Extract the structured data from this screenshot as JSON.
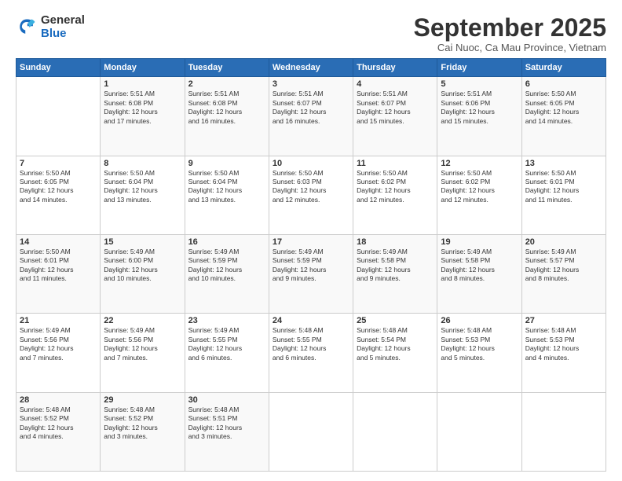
{
  "header": {
    "logo_general": "General",
    "logo_blue": "Blue",
    "title": "September 2025",
    "location": "Cai Nuoc, Ca Mau Province, Vietnam"
  },
  "days_of_week": [
    "Sunday",
    "Monday",
    "Tuesday",
    "Wednesday",
    "Thursday",
    "Friday",
    "Saturday"
  ],
  "weeks": [
    [
      {
        "day": "",
        "info": ""
      },
      {
        "day": "1",
        "info": "Sunrise: 5:51 AM\nSunset: 6:08 PM\nDaylight: 12 hours\nand 17 minutes."
      },
      {
        "day": "2",
        "info": "Sunrise: 5:51 AM\nSunset: 6:08 PM\nDaylight: 12 hours\nand 16 minutes."
      },
      {
        "day": "3",
        "info": "Sunrise: 5:51 AM\nSunset: 6:07 PM\nDaylight: 12 hours\nand 16 minutes."
      },
      {
        "day": "4",
        "info": "Sunrise: 5:51 AM\nSunset: 6:07 PM\nDaylight: 12 hours\nand 15 minutes."
      },
      {
        "day": "5",
        "info": "Sunrise: 5:51 AM\nSunset: 6:06 PM\nDaylight: 12 hours\nand 15 minutes."
      },
      {
        "day": "6",
        "info": "Sunrise: 5:50 AM\nSunset: 6:05 PM\nDaylight: 12 hours\nand 14 minutes."
      }
    ],
    [
      {
        "day": "7",
        "info": "Sunrise: 5:50 AM\nSunset: 6:05 PM\nDaylight: 12 hours\nand 14 minutes."
      },
      {
        "day": "8",
        "info": "Sunrise: 5:50 AM\nSunset: 6:04 PM\nDaylight: 12 hours\nand 13 minutes."
      },
      {
        "day": "9",
        "info": "Sunrise: 5:50 AM\nSunset: 6:04 PM\nDaylight: 12 hours\nand 13 minutes."
      },
      {
        "day": "10",
        "info": "Sunrise: 5:50 AM\nSunset: 6:03 PM\nDaylight: 12 hours\nand 12 minutes."
      },
      {
        "day": "11",
        "info": "Sunrise: 5:50 AM\nSunset: 6:02 PM\nDaylight: 12 hours\nand 12 minutes."
      },
      {
        "day": "12",
        "info": "Sunrise: 5:50 AM\nSunset: 6:02 PM\nDaylight: 12 hours\nand 12 minutes."
      },
      {
        "day": "13",
        "info": "Sunrise: 5:50 AM\nSunset: 6:01 PM\nDaylight: 12 hours\nand 11 minutes."
      }
    ],
    [
      {
        "day": "14",
        "info": "Sunrise: 5:50 AM\nSunset: 6:01 PM\nDaylight: 12 hours\nand 11 minutes."
      },
      {
        "day": "15",
        "info": "Sunrise: 5:49 AM\nSunset: 6:00 PM\nDaylight: 12 hours\nand 10 minutes."
      },
      {
        "day": "16",
        "info": "Sunrise: 5:49 AM\nSunset: 5:59 PM\nDaylight: 12 hours\nand 10 minutes."
      },
      {
        "day": "17",
        "info": "Sunrise: 5:49 AM\nSunset: 5:59 PM\nDaylight: 12 hours\nand 9 minutes."
      },
      {
        "day": "18",
        "info": "Sunrise: 5:49 AM\nSunset: 5:58 PM\nDaylight: 12 hours\nand 9 minutes."
      },
      {
        "day": "19",
        "info": "Sunrise: 5:49 AM\nSunset: 5:58 PM\nDaylight: 12 hours\nand 8 minutes."
      },
      {
        "day": "20",
        "info": "Sunrise: 5:49 AM\nSunset: 5:57 PM\nDaylight: 12 hours\nand 8 minutes."
      }
    ],
    [
      {
        "day": "21",
        "info": "Sunrise: 5:49 AM\nSunset: 5:56 PM\nDaylight: 12 hours\nand 7 minutes."
      },
      {
        "day": "22",
        "info": "Sunrise: 5:49 AM\nSunset: 5:56 PM\nDaylight: 12 hours\nand 7 minutes."
      },
      {
        "day": "23",
        "info": "Sunrise: 5:49 AM\nSunset: 5:55 PM\nDaylight: 12 hours\nand 6 minutes."
      },
      {
        "day": "24",
        "info": "Sunrise: 5:48 AM\nSunset: 5:55 PM\nDaylight: 12 hours\nand 6 minutes."
      },
      {
        "day": "25",
        "info": "Sunrise: 5:48 AM\nSunset: 5:54 PM\nDaylight: 12 hours\nand 5 minutes."
      },
      {
        "day": "26",
        "info": "Sunrise: 5:48 AM\nSunset: 5:53 PM\nDaylight: 12 hours\nand 5 minutes."
      },
      {
        "day": "27",
        "info": "Sunrise: 5:48 AM\nSunset: 5:53 PM\nDaylight: 12 hours\nand 4 minutes."
      }
    ],
    [
      {
        "day": "28",
        "info": "Sunrise: 5:48 AM\nSunset: 5:52 PM\nDaylight: 12 hours\nand 4 minutes."
      },
      {
        "day": "29",
        "info": "Sunrise: 5:48 AM\nSunset: 5:52 PM\nDaylight: 12 hours\nand 3 minutes."
      },
      {
        "day": "30",
        "info": "Sunrise: 5:48 AM\nSunset: 5:51 PM\nDaylight: 12 hours\nand 3 minutes."
      },
      {
        "day": "",
        "info": ""
      },
      {
        "day": "",
        "info": ""
      },
      {
        "day": "",
        "info": ""
      },
      {
        "day": "",
        "info": ""
      }
    ]
  ]
}
